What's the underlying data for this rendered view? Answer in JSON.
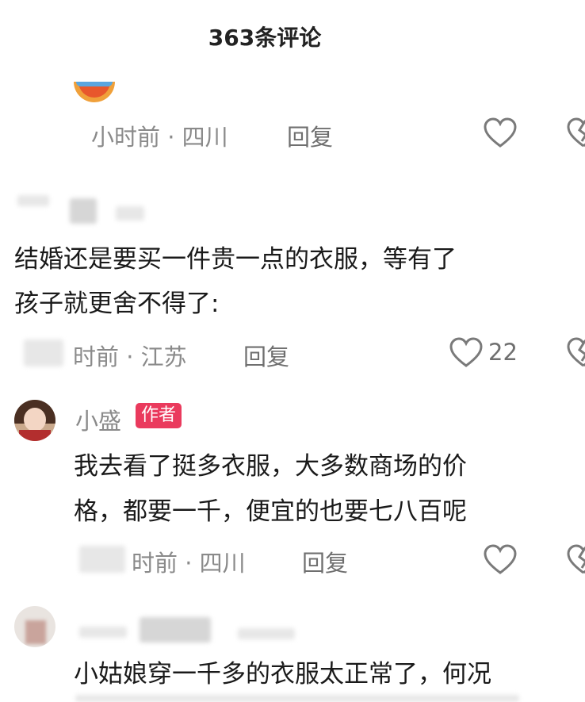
{
  "header": {
    "title": "363条评论"
  },
  "comments": [
    {
      "time_location": "小时前 · 四川",
      "reply": "回复",
      "likes": ""
    },
    {
      "lines": [
        "结婚还是要买一件贵一点的衣服，等有了",
        "孩子就更舍不得了:"
      ],
      "time_location": "时前 · 江苏",
      "reply": "回复",
      "likes": "22"
    },
    {
      "username": "小盛",
      "badge": "作者",
      "lines": [
        "我去看了挺多衣服，大多数商场的价",
        "格，都要一千，便宜的也要七八百呢"
      ],
      "time_location": "时前 · 四川",
      "reply": "回复",
      "likes": ""
    },
    {
      "lines": [
        "小姑娘穿一千多的衣服太正常了，何况"
      ]
    }
  ],
  "colors": {
    "badge": "#ea3a5d",
    "icon": "#7a7a7a"
  },
  "icons": [
    "heart-icon",
    "dislike-icon",
    "avatar"
  ]
}
